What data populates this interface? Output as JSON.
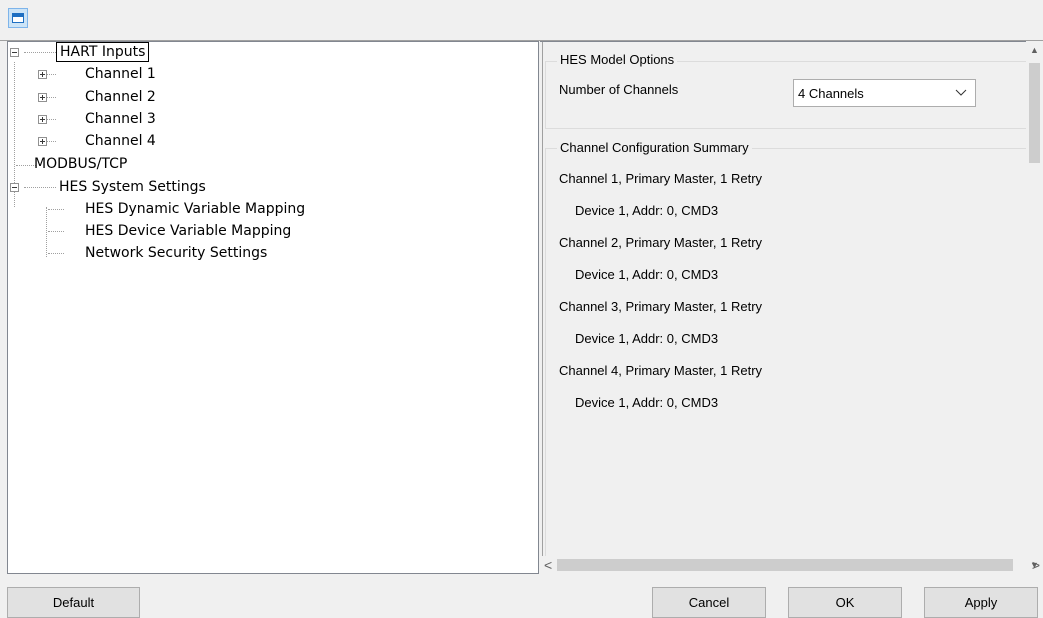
{
  "toolbar": {
    "icon": "window-icon"
  },
  "tree": {
    "root": "HART Inputs",
    "channels": [
      "Channel 1",
      "Channel 2",
      "Channel 3",
      "Channel 4"
    ],
    "modbus": "MODBUS/TCP",
    "system": "HES System Settings",
    "system_children": [
      "HES Dynamic Variable Mapping",
      "HES Device Variable Mapping",
      "Network Security Settings"
    ]
  },
  "options": {
    "group_title": "HES Model Options",
    "channels_label": "Number of Channels",
    "channels_value": "4 Channels"
  },
  "summary": {
    "group_title": "Channel Configuration Summary",
    "lines": [
      "Channel 1, Primary Master, 1 Retry",
      "Device 1, Addr: 0, CMD3",
      "Channel 2, Primary Master, 1 Retry",
      "Device 1, Addr: 0, CMD3",
      "Channel 3, Primary Master, 1 Retry",
      "Device 1, Addr: 0, CMD3",
      "Channel 4, Primary Master, 1 Retry",
      "Device 1, Addr: 0, CMD3"
    ]
  },
  "scroll": {
    "left_arrow": "<",
    "right_arrow": ">",
    "up_arrow": "▲",
    "down_arrow": "▼"
  },
  "buttons": {
    "default": "Default",
    "cancel": "Cancel",
    "ok": "OK",
    "apply": "Apply"
  }
}
